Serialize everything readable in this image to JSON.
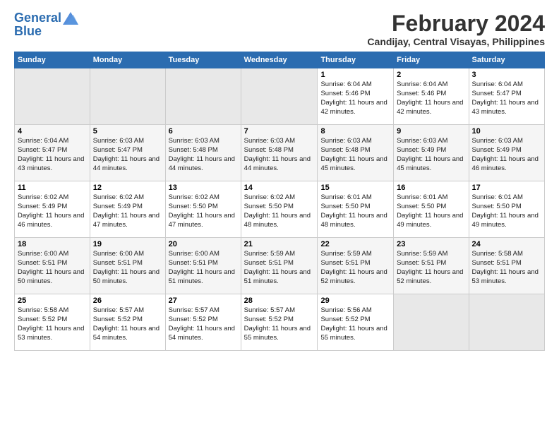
{
  "header": {
    "logo_line1": "General",
    "logo_line2": "Blue",
    "month": "February 2024",
    "location": "Candijay, Central Visayas, Philippines"
  },
  "days_of_week": [
    "Sunday",
    "Monday",
    "Tuesday",
    "Wednesday",
    "Thursday",
    "Friday",
    "Saturday"
  ],
  "weeks": [
    [
      {
        "day": "",
        "info": ""
      },
      {
        "day": "",
        "info": ""
      },
      {
        "day": "",
        "info": ""
      },
      {
        "day": "",
        "info": ""
      },
      {
        "day": "1",
        "info": "Sunrise: 6:04 AM\nSunset: 5:46 PM\nDaylight: 11 hours\nand 42 minutes."
      },
      {
        "day": "2",
        "info": "Sunrise: 6:04 AM\nSunset: 5:46 PM\nDaylight: 11 hours\nand 42 minutes."
      },
      {
        "day": "3",
        "info": "Sunrise: 6:04 AM\nSunset: 5:47 PM\nDaylight: 11 hours\nand 43 minutes."
      }
    ],
    [
      {
        "day": "4",
        "info": "Sunrise: 6:04 AM\nSunset: 5:47 PM\nDaylight: 11 hours\nand 43 minutes."
      },
      {
        "day": "5",
        "info": "Sunrise: 6:03 AM\nSunset: 5:47 PM\nDaylight: 11 hours\nand 44 minutes."
      },
      {
        "day": "6",
        "info": "Sunrise: 6:03 AM\nSunset: 5:48 PM\nDaylight: 11 hours\nand 44 minutes."
      },
      {
        "day": "7",
        "info": "Sunrise: 6:03 AM\nSunset: 5:48 PM\nDaylight: 11 hours\nand 44 minutes."
      },
      {
        "day": "8",
        "info": "Sunrise: 6:03 AM\nSunset: 5:48 PM\nDaylight: 11 hours\nand 45 minutes."
      },
      {
        "day": "9",
        "info": "Sunrise: 6:03 AM\nSunset: 5:49 PM\nDaylight: 11 hours\nand 45 minutes."
      },
      {
        "day": "10",
        "info": "Sunrise: 6:03 AM\nSunset: 5:49 PM\nDaylight: 11 hours\nand 46 minutes."
      }
    ],
    [
      {
        "day": "11",
        "info": "Sunrise: 6:02 AM\nSunset: 5:49 PM\nDaylight: 11 hours\nand 46 minutes."
      },
      {
        "day": "12",
        "info": "Sunrise: 6:02 AM\nSunset: 5:49 PM\nDaylight: 11 hours\nand 47 minutes."
      },
      {
        "day": "13",
        "info": "Sunrise: 6:02 AM\nSunset: 5:50 PM\nDaylight: 11 hours\nand 47 minutes."
      },
      {
        "day": "14",
        "info": "Sunrise: 6:02 AM\nSunset: 5:50 PM\nDaylight: 11 hours\nand 48 minutes."
      },
      {
        "day": "15",
        "info": "Sunrise: 6:01 AM\nSunset: 5:50 PM\nDaylight: 11 hours\nand 48 minutes."
      },
      {
        "day": "16",
        "info": "Sunrise: 6:01 AM\nSunset: 5:50 PM\nDaylight: 11 hours\nand 49 minutes."
      },
      {
        "day": "17",
        "info": "Sunrise: 6:01 AM\nSunset: 5:50 PM\nDaylight: 11 hours\nand 49 minutes."
      }
    ],
    [
      {
        "day": "18",
        "info": "Sunrise: 6:00 AM\nSunset: 5:51 PM\nDaylight: 11 hours\nand 50 minutes."
      },
      {
        "day": "19",
        "info": "Sunrise: 6:00 AM\nSunset: 5:51 PM\nDaylight: 11 hours\nand 50 minutes."
      },
      {
        "day": "20",
        "info": "Sunrise: 6:00 AM\nSunset: 5:51 PM\nDaylight: 11 hours\nand 51 minutes."
      },
      {
        "day": "21",
        "info": "Sunrise: 5:59 AM\nSunset: 5:51 PM\nDaylight: 11 hours\nand 51 minutes."
      },
      {
        "day": "22",
        "info": "Sunrise: 5:59 AM\nSunset: 5:51 PM\nDaylight: 11 hours\nand 52 minutes."
      },
      {
        "day": "23",
        "info": "Sunrise: 5:59 AM\nSunset: 5:51 PM\nDaylight: 11 hours\nand 52 minutes."
      },
      {
        "day": "24",
        "info": "Sunrise: 5:58 AM\nSunset: 5:51 PM\nDaylight: 11 hours\nand 53 minutes."
      }
    ],
    [
      {
        "day": "25",
        "info": "Sunrise: 5:58 AM\nSunset: 5:52 PM\nDaylight: 11 hours\nand 53 minutes."
      },
      {
        "day": "26",
        "info": "Sunrise: 5:57 AM\nSunset: 5:52 PM\nDaylight: 11 hours\nand 54 minutes."
      },
      {
        "day": "27",
        "info": "Sunrise: 5:57 AM\nSunset: 5:52 PM\nDaylight: 11 hours\nand 54 minutes."
      },
      {
        "day": "28",
        "info": "Sunrise: 5:57 AM\nSunset: 5:52 PM\nDaylight: 11 hours\nand 55 minutes."
      },
      {
        "day": "29",
        "info": "Sunrise: 5:56 AM\nSunset: 5:52 PM\nDaylight: 11 hours\nand 55 minutes."
      },
      {
        "day": "",
        "info": ""
      },
      {
        "day": "",
        "info": ""
      }
    ]
  ]
}
